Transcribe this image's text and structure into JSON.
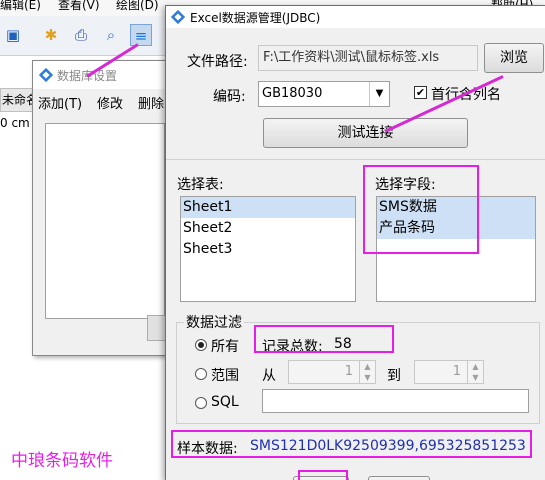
{
  "bg_app": {
    "menu": [
      "编辑(E)",
      "查看(V)",
      "绘图(D)",
      "帮助(H)"
    ],
    "tab_label": "未命名",
    "ruler_label": "0 cm"
  },
  "db_window": {
    "title": "数据库设置",
    "menu": [
      "添加(T)",
      "修改",
      "删除"
    ]
  },
  "dialog": {
    "title": "Excel数据源管理(JDBC)",
    "file_path_label": "文件路径:",
    "file_path_value": "F:\\工作资料\\测试\\鼠标标签.xls",
    "browse_button": "浏览",
    "encoding_label": "编码:",
    "encoding_value": "GB18030",
    "first_row_label": "首行含列名",
    "first_row_checked": true,
    "test_button": "测试连接",
    "table_label": "选择表:",
    "tables": [
      "Sheet1",
      "Sheet2",
      "Sheet3"
    ],
    "field_label": "选择字段:",
    "fields": [
      "SMS数据",
      "产品条码"
    ],
    "filter_group": "数据过滤",
    "filter_all": "所有",
    "record_count_label": "记录总数:",
    "record_count": "58",
    "filter_range": "范围",
    "from_label": "从",
    "from_value": "1",
    "to_label": "到",
    "to_value": "1",
    "filter_sql": "SQL",
    "sample_label": "样本数据:",
    "sample_value": "SMS121D0LK92509399,695325851253"
  },
  "watermark": "中琅条码软件",
  "colors": {
    "highlight": "#e81ee8",
    "arrow": "#d42ad4",
    "sample_text": "#1f2fb0",
    "list_selected": "#cde0f5"
  }
}
